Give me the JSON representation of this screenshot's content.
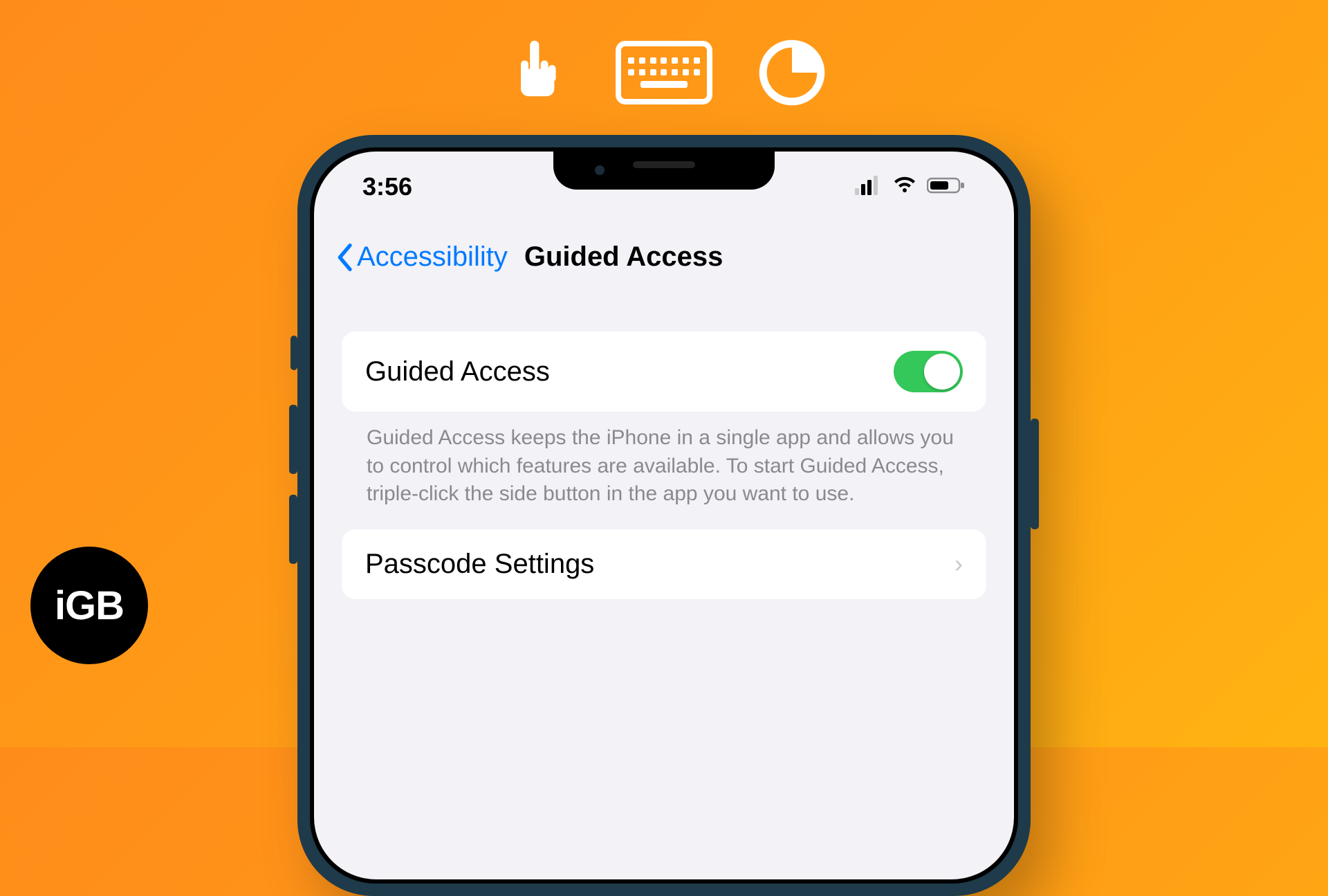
{
  "status": {
    "time": "3:56"
  },
  "nav": {
    "back_label": "Accessibility",
    "title": "Guided Access"
  },
  "settings": {
    "toggle_label": "Guided Access",
    "toggle_on": true,
    "description": "Guided Access keeps the iPhone in a single app and allows you to control which features are available. To start Guided Access, triple-click the side button in the app you want to use.",
    "passcode_label": "Passcode Settings"
  },
  "branding": {
    "logo_text": "iGB"
  },
  "colors": {
    "ios_blue": "#007aff",
    "toggle_green": "#34c759"
  },
  "decor_icons": [
    "touch-icon",
    "keyboard-icon",
    "timer-icon"
  ]
}
